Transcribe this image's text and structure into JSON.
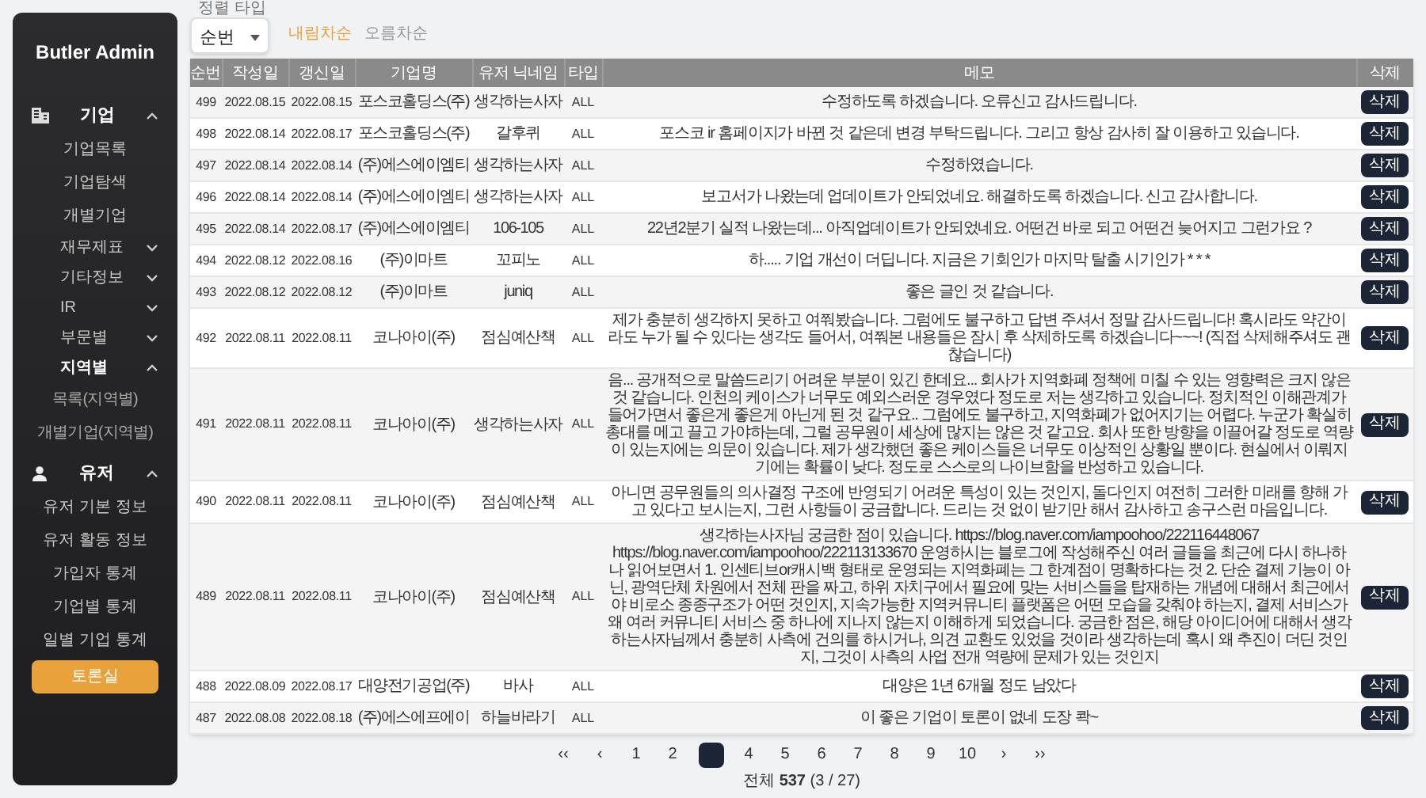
{
  "sidebar": {
    "title": "Butler Admin",
    "sections": [
      {
        "label": "기업",
        "expanded": true,
        "items": [
          {
            "kind": "link",
            "label": "기업목록",
            "selected": false
          },
          {
            "kind": "link",
            "label": "기업탐색",
            "selected": false
          },
          {
            "kind": "link",
            "label": "개별기업",
            "selected": false
          },
          {
            "kind": "group",
            "label": "재무제표",
            "expanded": false
          },
          {
            "kind": "group",
            "label": "기타정보",
            "expanded": false
          },
          {
            "kind": "group",
            "label": "IR",
            "expanded": false
          },
          {
            "kind": "group",
            "label": "부문별",
            "expanded": false
          },
          {
            "kind": "group",
            "label": "지역별",
            "expanded": true,
            "children": [
              {
                "kind": "link",
                "label": "목록(지역별)",
                "selected": false
              },
              {
                "kind": "link",
                "label": "개별기업(지역별)",
                "selected": false
              }
            ]
          }
        ]
      },
      {
        "label": "유저",
        "expanded": true,
        "items": [
          {
            "kind": "link",
            "label": "유저 기본 정보",
            "selected": false
          },
          {
            "kind": "link",
            "label": "유저 활동 정보",
            "selected": false
          },
          {
            "kind": "link",
            "label": "가입자 통계",
            "selected": false
          },
          {
            "kind": "link",
            "label": "기업별 통계",
            "selected": false
          },
          {
            "kind": "link",
            "label": "일별 기업 통계",
            "selected": false
          },
          {
            "kind": "link",
            "label": "토론실",
            "selected": true
          }
        ]
      }
    ]
  },
  "sort": {
    "label": "정렬 타입",
    "value": "순번",
    "orders": [
      {
        "label": "내림차순",
        "selected": true
      },
      {
        "label": "오름차순",
        "selected": false
      }
    ]
  },
  "table": {
    "columns": [
      "순번",
      "작성일",
      "갱신일",
      "기업명",
      "유저 닉네임",
      "타입",
      "메모",
      "삭제"
    ],
    "rows": [
      {
        "cells": [
          "499",
          "2022.08.15",
          "2022.08.15",
          "포스코홀딩스(주)",
          "생각하는사자",
          "ALL",
          "수정하도록 하겠습니다. 오류신고 감사드립니다."
        ],
        "button": "삭제"
      },
      {
        "cells": [
          "498",
          "2022.08.14",
          "2022.08.17",
          "포스코홀딩스(주)",
          "갈후퀴",
          "ALL",
          "포스코 ir 홈페이지가 바뀐 것 같은데 변경 부탁드립니다. 그리고 항상 감사히 잘 이용하고 있습니다."
        ],
        "button": "삭제"
      },
      {
        "cells": [
          "497",
          "2022.08.14",
          "2022.08.14",
          "(주)에스에이엠티",
          "생각하는사자",
          "ALL",
          "수정하였습니다."
        ],
        "button": "삭제"
      },
      {
        "cells": [
          "496",
          "2022.08.14",
          "2022.08.14",
          "(주)에스에이엠티",
          "생각하는사자",
          "ALL",
          "보고서가 나왔는데 업데이트가 안되었네요. 해결하도록 하겠습니다. 신고 감사합니다."
        ],
        "button": "삭제"
      },
      {
        "cells": [
          "495",
          "2022.08.14",
          "2022.08.17",
          "(주)에스에이엠티",
          "106-105",
          "ALL",
          "22년2분기 실적 나왔는데... 아직업데이트가 안되었네요. 어떤건 바로 되고 어떤건 늦어지고 그런가요 ?"
        ],
        "button": "삭제"
      },
      {
        "cells": [
          "494",
          "2022.08.12",
          "2022.08.16",
          "(주)이마트",
          "꼬피노",
          "ALL",
          "하..... 기업 개선이 더딥니다. 지금은 기회인가 마지막 탈출 시기인가 * * *"
        ],
        "button": "삭제"
      },
      {
        "cells": [
          "493",
          "2022.08.12",
          "2022.08.12",
          "(주)이마트",
          "juniq",
          "ALL",
          "좋은 글인 것 같습니다."
        ],
        "button": "삭제"
      },
      {
        "cells": [
          "492",
          "2022.08.11",
          "2022.08.11",
          "코나아이(주)",
          "점심예산책",
          "ALL",
          "제가 충분히 생각하지 못하고 여쭤봤습니다. 그럼에도 불구하고 답변 주셔서 정말 감사드립니다! 혹시라도 약간이라도 누가 될 수 있다는 생각도 들어서, 여쭤본 내용들은 잠시 후 삭제하도록 하겠습니다~~~! (직접 삭제해주셔도 괜찮습니다)"
        ],
        "button": "삭제"
      },
      {
        "cells": [
          "491",
          "2022.08.11",
          "2022.08.11",
          "코나아이(주)",
          "생각하는사자",
          "ALL",
          "음... 공개적으로 말씀드리기 어려운 부분이 있긴 한데요... 회사가 지역화폐 정책에 미칠 수 있는 영향력은 크지 않은 것 같습니다. 인천의 케이스가 너무도 예외스러운 경우였다 정도로 저는 생각하고 있습니다. 정치적인 이해관계가 들어가면서 좋은게 좋은게 아닌게 된 것 같구요.. 그럼에도 불구하고, 지역화폐가 없어지기는 어렵다. 누군가 확실히 총대를 메고 끌고 가야하는데, 그럴 공무원이 세상에 많지는 않은 것 같고요. 회사 또한 방향을 이끌어갈 정도로 역량이 있는지에는 의문이 있습니다. 제가 생각했던 좋은 케이스들은 너무도 이상적인 상황일 뿐이다. 현실에서 이뤄지기에는 확률이 낮다. 정도로 스스로의 나이브함을 반성하고 있습니다."
        ],
        "button": "삭제"
      },
      {
        "cells": [
          "490",
          "2022.08.11",
          "2022.08.11",
          "코나아이(주)",
          "점심예산책",
          "ALL",
          "아니면 공무원들의 의사결정 구조에 반영되기 어려운 특성이 있는 것인지, 돌다인지 여전히 그러한 미래를 향해 가고 있다고 보시는지, 그런 사항들이 궁금합니다. 드리는 것 없이 받기만 해서 감사하고 송구스런 마음입니다."
        ],
        "button": "삭제"
      },
      {
        "cells": [
          "489",
          "2022.08.11",
          "2022.08.11",
          "코나아이(주)",
          "점심예산책",
          "ALL",
          "생각하는사자님 궁금한 점이 있습니다. https://blog.naver.com/iampoohoo/222116448067 https://blog.naver.com/iampoohoo/222113133670 운영하시는 블로그에 작성해주신 여러 글들을 최근에 다시 하나하나 읽어보면서 1. 인센티브or캐시백 형태로 운영되는 지역화폐는 그 한계점이 명확하다는 것 2. 단순 결제 기능이 아닌, 광역단체 차원에서 전체 판을 짜고, 하위 자치구에서 필요에 맞는 서비스들을 탑재하는 개념에 대해서 최근에서야 비로소 종종구조가 어떤 것인지, 지속가능한 지역커뮤니티 플랫폼은 어떤 모습을 갖춰야 하는지, 결제 서비스가 왜 여러 커뮤니티 서비스 중 하나에 지나지 않는지 이해하게 되었습니다. 궁금한 점은, 해당 아이디어에 대해서 생각하는사자님께서 충분히 사측에 건의를 하시거나, 의견 교환도 있었을 것이라 생각하는데 혹시 왜 추진이 더딘 것인지, 그것이 사측의 사업 전개 역량에 문제가 있는 것인지"
        ],
        "button": "삭제"
      },
      {
        "cells": [
          "488",
          "2022.08.09",
          "2022.08.17",
          "대양전기공업(주)",
          "바사",
          "ALL",
          "대양은 1년 6개월 정도 남았다"
        ],
        "button": "삭제"
      },
      {
        "cells": [
          "487",
          "2022.08.08",
          "2022.08.18",
          "(주)에스에프에이",
          "하늘바라기",
          "ALL",
          "이 좋은 기업이 토론이 없네 도장 콱~"
        ],
        "button": "삭제"
      }
    ]
  },
  "pagination": {
    "first": "‹‹",
    "prev": "‹",
    "pages": [
      {
        "label": "1",
        "selected": false
      },
      {
        "label": "2",
        "selected": false
      },
      {
        "selected": true
      },
      {
        "label": "4",
        "selected": false
      },
      {
        "label": "5",
        "selected": false
      },
      {
        "label": "6",
        "selected": false
      },
      {
        "label": "7",
        "selected": false
      },
      {
        "label": "8",
        "selected": false
      },
      {
        "label": "9",
        "selected": false
      },
      {
        "label": "10",
        "selected": false
      }
    ],
    "next": "›",
    "last": "››"
  },
  "total": "전체 **537** (3 / 27)"
}
